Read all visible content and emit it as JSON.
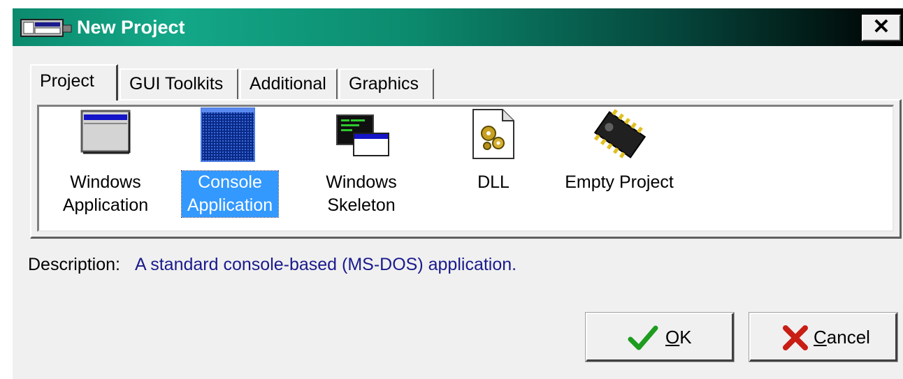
{
  "window": {
    "title": "New Project",
    "close_label": "✕",
    "titlebar_colors": [
      "#13a888",
      "#000000"
    ]
  },
  "tabs": [
    {
      "label": "Project",
      "active": true
    },
    {
      "label": "GUI Toolkits",
      "active": false
    },
    {
      "label": "Additional",
      "active": false
    },
    {
      "label": "Graphics",
      "active": false
    }
  ],
  "templates": [
    {
      "label": "Windows\nApplication",
      "icon": "window-app-icon",
      "selected": false
    },
    {
      "label": "Console\nApplication",
      "icon": "console-app-icon",
      "selected": true
    },
    {
      "label": "Windows\nSkeleton",
      "icon": "windows-skeleton-icon",
      "selected": false
    },
    {
      "label": "DLL",
      "icon": "dll-gear-icon",
      "selected": false
    },
    {
      "label": "Empty Project",
      "icon": "chip-icon",
      "selected": false
    }
  ],
  "description": {
    "label": "Description:",
    "text": "A standard console-based (MS-DOS) application."
  },
  "buttons": {
    "ok_label": "OK",
    "ok_icon": "checkmark-icon",
    "cancel_label": "Cancel",
    "cancel_icon": "x-icon"
  },
  "colors": {
    "selection": "#3399ff",
    "description_text": "#1a1a8c",
    "ok_check": "#1e9c1e",
    "cancel_x": "#c81e14"
  }
}
